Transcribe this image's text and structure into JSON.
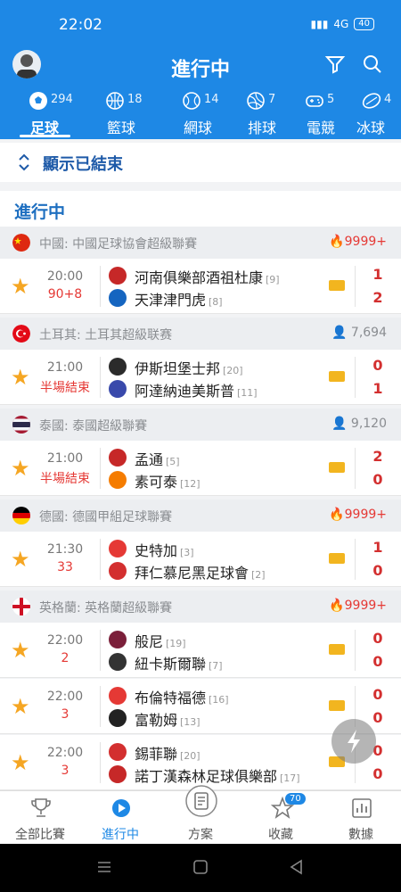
{
  "status_bar": {
    "time": "22:02",
    "network": "4G",
    "battery": "40"
  },
  "app_bar": {
    "title": "進行中"
  },
  "sport_tabs": [
    {
      "label": "足球",
      "count": "294",
      "icon": "soccer-icon"
    },
    {
      "label": "籃球",
      "count": "18",
      "icon": "basketball-icon"
    },
    {
      "label": "網球",
      "count": "14",
      "icon": "tennis-icon"
    },
    {
      "label": "排球",
      "count": "7",
      "icon": "volleyball-icon"
    },
    {
      "label": "電競",
      "count": "5",
      "icon": "gamepad-icon"
    },
    {
      "label": "冰球",
      "count": "4",
      "icon": "hockey-icon"
    }
  ],
  "toggle": {
    "label": "顯示已結束"
  },
  "section": {
    "title": "進行中"
  },
  "leagues": [
    {
      "name": "中國: 中國足球協會超級聯賽",
      "flag": "china",
      "heat": "9999+",
      "matches": [
        {
          "time": "20:00",
          "status": "90+8",
          "home": "河南俱樂部酒祖杜康",
          "home_rank": "[9]",
          "away": "天津津門虎",
          "away_rank": "[8]",
          "home_score": "1",
          "away_score": "2"
        }
      ]
    },
    {
      "name": "土耳其: 土耳其超級联赛",
      "flag": "turkey",
      "viewers": "7,694",
      "matches": [
        {
          "time": "21:00",
          "status": "半場結束",
          "home": "伊斯坦堡士邦",
          "home_rank": "[20]",
          "away": "阿達納迪美斯普",
          "away_rank": "[11]",
          "home_score": "0",
          "away_score": "1"
        }
      ]
    },
    {
      "name": "泰國: 泰國超級聯賽",
      "flag": "thailand",
      "viewers": "9,120",
      "matches": [
        {
          "time": "21:00",
          "status": "半場結束",
          "home": "孟通",
          "home_rank": "[5]",
          "away": "素可泰",
          "away_rank": "[12]",
          "home_score": "2",
          "away_score": "0"
        }
      ]
    },
    {
      "name": "德國: 德國甲組足球聯賽",
      "flag": "germany",
      "heat": "9999+",
      "matches": [
        {
          "time": "21:30",
          "status": "33",
          "home": "史特加",
          "home_rank": "[3]",
          "away": "拜仁慕尼黑足球會",
          "away_rank": "[2]",
          "home_score": "1",
          "away_score": "0"
        }
      ]
    },
    {
      "name": "英格蘭: 英格蘭超級聯賽",
      "flag": "england",
      "heat": "9999+",
      "matches": [
        {
          "time": "22:00",
          "status": "2",
          "home": "般尼",
          "home_rank": "[19]",
          "away": "紐卡斯爾聯",
          "away_rank": "[7]",
          "home_score": "0",
          "away_score": "0"
        },
        {
          "time": "22:00",
          "status": "3",
          "home": "布倫特福德",
          "home_rank": "[16]",
          "away": "富勒姆",
          "away_rank": "[13]",
          "home_score": "0",
          "away_score": "0"
        },
        {
          "time": "22:00",
          "status": "3",
          "home": "錫菲聯",
          "home_rank": "[20]",
          "away": "諾丁漢森林足球俱樂部",
          "away_rank": "[17]",
          "home_score": "0",
          "away_score": "0"
        }
      ]
    }
  ],
  "bottom_nav": [
    {
      "label": "全部比賽",
      "icon": "trophy-icon"
    },
    {
      "label": "進行中",
      "icon": "play-icon"
    },
    {
      "label": "方案",
      "icon": "document-icon"
    },
    {
      "label": "收藏",
      "icon": "star-outline-icon",
      "badge": "70"
    },
    {
      "label": "數據",
      "icon": "chart-icon"
    }
  ],
  "colors": {
    "primary": "#1e88e5",
    "score": "#d32f2f",
    "star": "#f5a623",
    "heat": "#e53935"
  }
}
